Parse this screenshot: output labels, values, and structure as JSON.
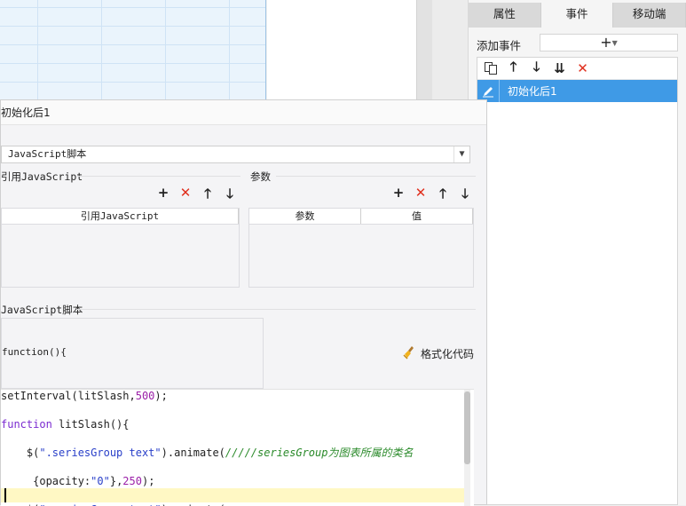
{
  "right_panel": {
    "tabs": [
      "属性",
      "事件",
      "移动端"
    ],
    "active_tab": "事件",
    "add_event_label": "添加事件",
    "add_button_glyph": "+",
    "event_toolbar_icons": [
      "copy-icon",
      "arrow-up-icon",
      "arrow-down-icon",
      "move-bottom-icon",
      "delete-icon"
    ],
    "events": [
      "初始化后1"
    ]
  },
  "dialog": {
    "title": "初始化后1",
    "script_type": "JavaScript脚本",
    "ref_section_label": "引用JavaScript",
    "param_section_label": "参数",
    "ref_table_header": "引用JavaScript",
    "param_table_headers": [
      "参数",
      "值"
    ],
    "script_section_label": "JavaScript脚本",
    "function_text": "function(){",
    "format_button_label": "格式化代码"
  },
  "code": {
    "lines": [
      "setInterval(litSlash,500);",
      "function litSlash(){",
      "    $(\".seriesGroup text\").animate(/////seriesGroup为图表所属的类名",
      "     {opacity:\"0\"},250);",
      "    $(\".seriesGroup text\").animate("
    ]
  },
  "colors": {
    "accent": "#3f9ae6",
    "delete_red": "#e0301e",
    "keyword": "#7b2bd0",
    "string": "#2a40c9",
    "comment": "#2a8a2a"
  }
}
